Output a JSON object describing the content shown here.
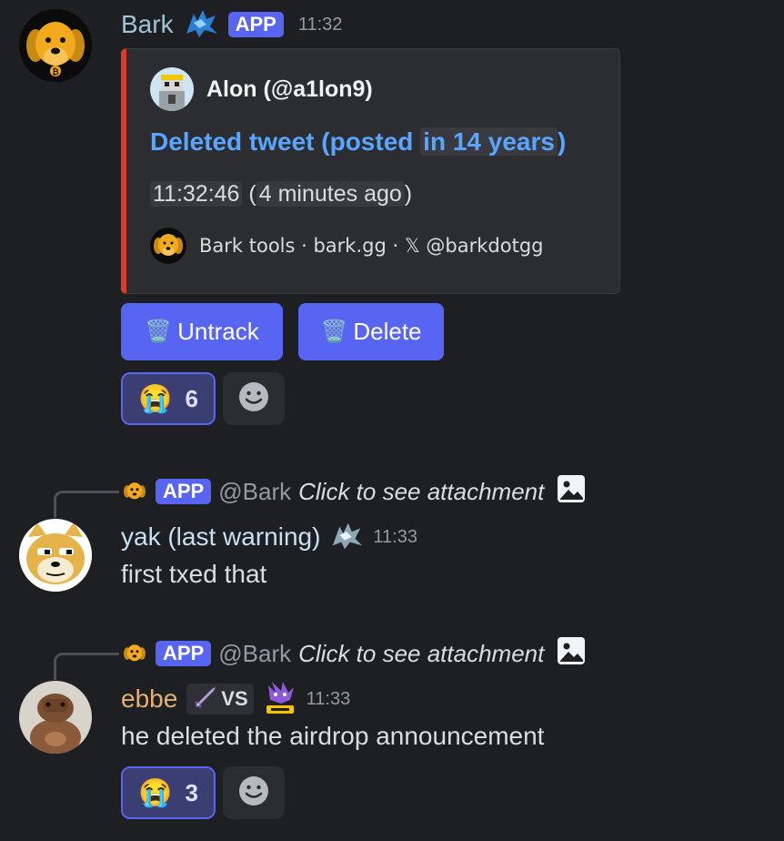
{
  "messages": [
    {
      "author": "Bark",
      "tag": "APP",
      "time": "11:32",
      "embed": {
        "author": "Alon (@a1lon9)",
        "title_pre": "Deleted tweet (posted ",
        "title_hl": "in 14 years",
        "title_post": ")",
        "timestamp": "11:32:46",
        "relative": "4 minutes ago",
        "footer": "Bark tools · bark.gg · 𝕏 @barkdotgg"
      },
      "buttons": [
        {
          "icon": "🗑️",
          "label": "Untrack"
        },
        {
          "icon": "🗑️",
          "label": "Delete"
        }
      ],
      "reaction": {
        "emoji": "😭",
        "count": "6"
      }
    },
    {
      "reply": {
        "tag": "APP",
        "name": "@Bark",
        "text": "Click to see attachment"
      },
      "author": "yak (last warning)",
      "time": "11:33",
      "text": "first txed that"
    },
    {
      "reply": {
        "tag": "APP",
        "name": "@Bark",
        "text": "Click to see attachment"
      },
      "author": "ebbe",
      "role": "VS",
      "time": "11:33",
      "text": "he deleted the airdrop announcement",
      "reaction": {
        "emoji": "😭",
        "count": "3"
      }
    }
  ],
  "colors": {
    "background": "#1e1f22",
    "embed_bg": "#2b2d31",
    "embed_accent": "#e03a2f",
    "blurple": "#5865f2",
    "link": "#58a6ff",
    "bark_name": "#9fc4d8",
    "yak_name": "#c8e0f0",
    "ebbe_name": "#e2b072"
  },
  "icons": [
    "golden-retriever-avatar",
    "wolf-icon",
    "attachment-image-icon",
    "smiley-add-reaction-icon",
    "trash-icon",
    "doge-avatar",
    "capybara-avatar",
    "sword-icon",
    "hodl-icon"
  ]
}
